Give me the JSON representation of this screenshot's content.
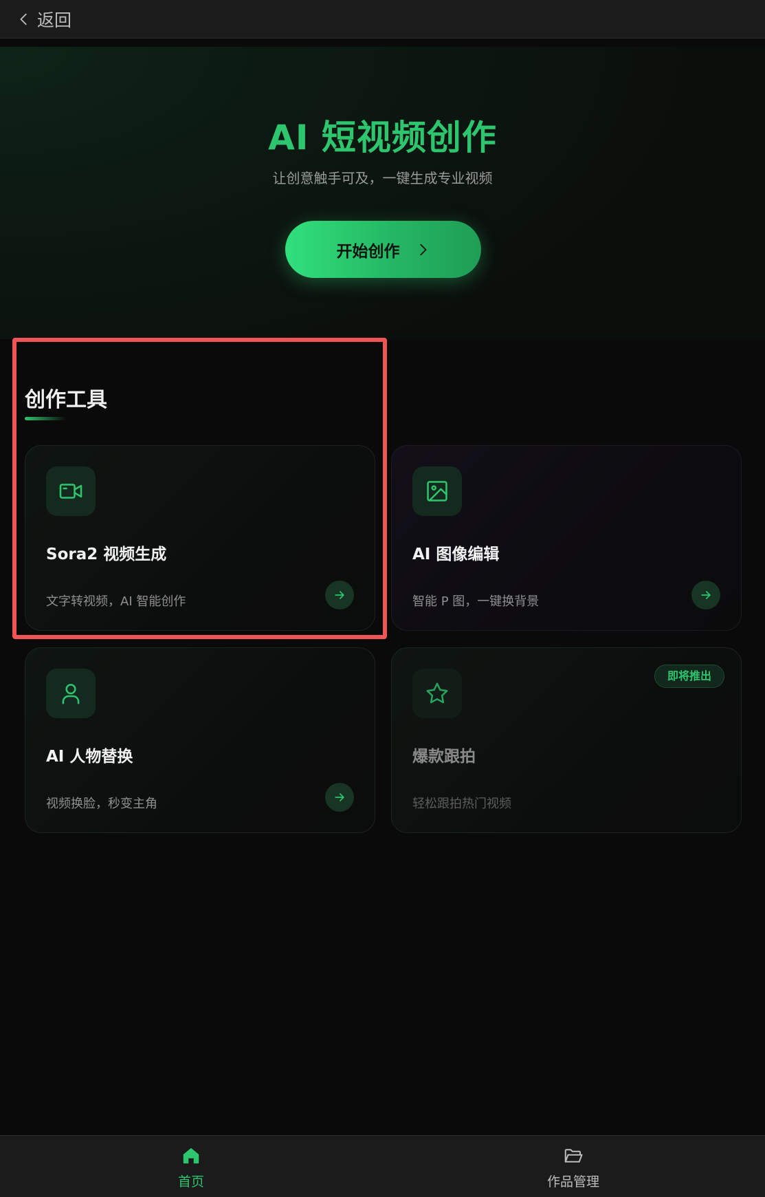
{
  "header": {
    "back_label": "返回"
  },
  "hero": {
    "title": "AI 短视频创作",
    "subtitle": "让创意触手可及，一键生成专业视频",
    "cta_label": "开始创作"
  },
  "section": {
    "title": "创作工具"
  },
  "tools": [
    {
      "title": "Sora2 视频生成",
      "desc": "文字转视频，AI 智能创作",
      "icon": "video-camera-icon"
    },
    {
      "title": "AI 图像编辑",
      "desc": "智能 P 图，一键换背景",
      "icon": "image-icon"
    },
    {
      "title": "AI 人物替换",
      "desc": "视频换脸，秒变主角",
      "icon": "user-icon"
    },
    {
      "title": "爆款跟拍",
      "desc": "轻松跟拍热门视频",
      "icon": "star-icon",
      "badge": "即将推出"
    }
  ],
  "bottom_nav": [
    {
      "label": "首页",
      "icon": "home-icon",
      "active": true
    },
    {
      "label": "作品管理",
      "icon": "folder-icon",
      "active": false
    }
  ],
  "colors": {
    "accent": "#2ec56f",
    "background": "#0a0a0a",
    "highlight": "#f05454"
  }
}
